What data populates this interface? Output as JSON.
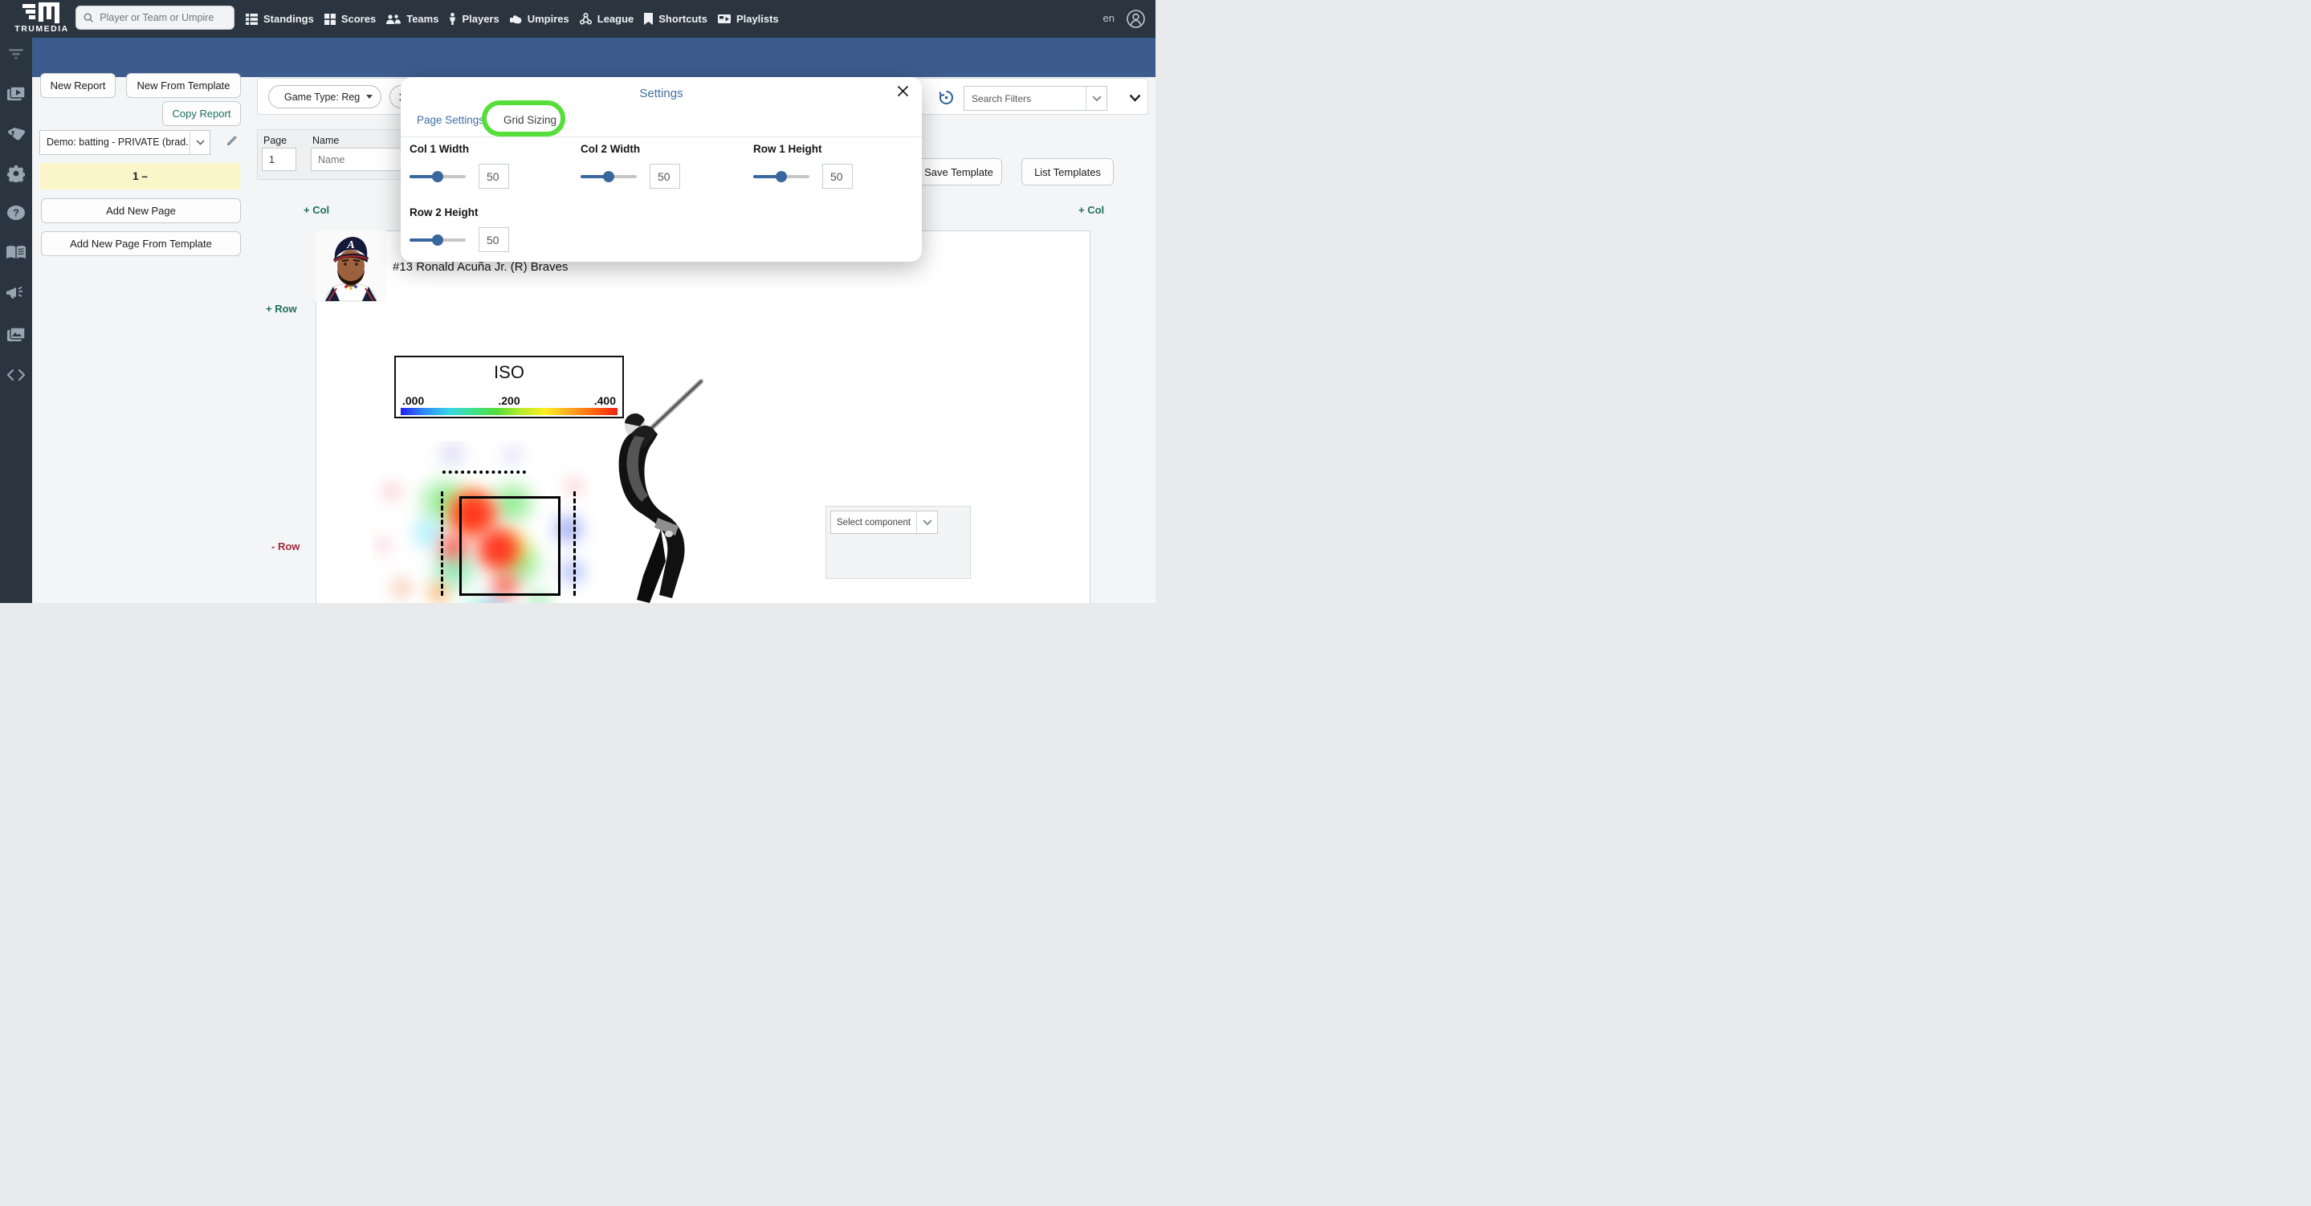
{
  "topnav": {
    "logo_text": "TRUMEDIA",
    "search_placeholder": "Player or Team or Umpire",
    "items": [
      {
        "label": "Standings"
      },
      {
        "label": "Scores"
      },
      {
        "label": "Teams"
      },
      {
        "label": "Players"
      },
      {
        "label": "Umpires"
      },
      {
        "label": "League"
      },
      {
        "label": "Shortcuts"
      },
      {
        "label": "Playlists"
      }
    ],
    "language": "en"
  },
  "left_panel": {
    "new_report": "New Report",
    "new_from_template": "New From Template",
    "copy_report": "Copy Report",
    "report_select_value": "Demo: batting - PRIVATE (brad...",
    "page_row_label": "1 –",
    "add_new_page": "Add New Page",
    "add_new_page_from_template": "Add New Page From Template"
  },
  "toolbar": {
    "chips": [
      {
        "label": "Game Type: Reg"
      }
    ],
    "search_filters_placeholder": "Search Filters"
  },
  "template_buttons": {
    "save": "Save Template",
    "list": "List Templates"
  },
  "page_form": {
    "page_header": "Page",
    "name_header": "Name",
    "page_value": "1",
    "name_placeholder": "Name"
  },
  "grid_controls": {
    "add_col_left": "+ Col",
    "add_col_right": "+ Col",
    "add_row": "+ Row",
    "remove_row": "- Row"
  },
  "player_header": {
    "name": "#13 Ronald Acuña Jr. (R) Braves"
  },
  "settings_modal": {
    "title": "Settings",
    "tabs": [
      {
        "label": "Page Settings"
      },
      {
        "label": "Grid Sizing"
      }
    ],
    "fields": [
      {
        "label": "Col 1 Width",
        "value": "50"
      },
      {
        "label": "Col 2 Width",
        "value": "50"
      },
      {
        "label": "Row 1 Height",
        "value": "50"
      },
      {
        "label": "Row 2 Height",
        "value": "50"
      }
    ]
  },
  "heatmap": {
    "legend_title": "ISO",
    "ticks": [
      ".000",
      ".200",
      ".400"
    ]
  },
  "component_select": {
    "placeholder": "Select component"
  },
  "colors": {
    "accent_green": "#1e6f5c",
    "remove_red": "#a12940",
    "link_blue": "#3f6fa5",
    "annotation_green": "#56DF3A",
    "slider_blue": "#38679e",
    "topbar_blue": "#3d5c8e",
    "nav_dark": "#2b3540",
    "highlight_yellow": "#faf6c9"
  }
}
